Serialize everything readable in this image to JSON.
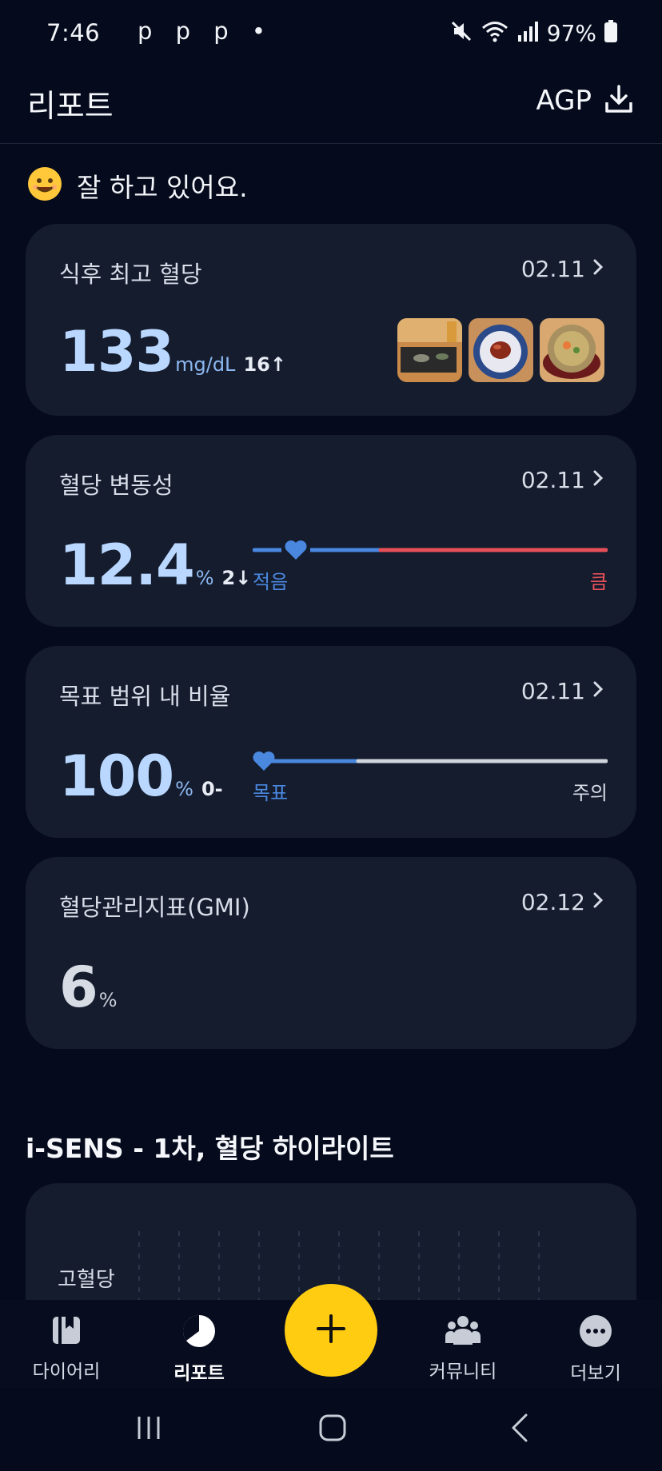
{
  "status_bar": {
    "time": "7:46",
    "notifications": "p p p •",
    "battery": "97%"
  },
  "header": {
    "title": "리포트",
    "agp_label": "AGP"
  },
  "greeting": {
    "text": "잘 하고 있어요."
  },
  "cards": {
    "post_meal": {
      "label": "식후 최고 혈당",
      "date": "02.11",
      "value": "133",
      "unit": "mg/dL",
      "delta": "16↑"
    },
    "variability": {
      "label": "혈당 변동성",
      "date": "02.11",
      "value": "12.4",
      "unit": "%",
      "delta": "2↓",
      "scale_low": "적음",
      "scale_high": "큼",
      "marker_fraction": 0.12
    },
    "time_in_range": {
      "label": "목표 범위 내 비율",
      "date": "02.11",
      "value": "100",
      "unit": "%",
      "delta": "0-",
      "scale_low": "목표",
      "scale_high": "주의",
      "marker_fraction": 0.0
    },
    "gmi": {
      "label": "혈당관리지표(GMI)",
      "date": "02.12",
      "value": "6",
      "unit": "%"
    }
  },
  "section": {
    "title": "i-SENS - 1차, 혈당 하이라이트",
    "high_label": "고혈당"
  },
  "bottom_nav": {
    "items": [
      {
        "label": "다이어리"
      },
      {
        "label": "리포트"
      },
      {
        "label": "커뮤니티"
      },
      {
        "label": "더보기"
      }
    ]
  },
  "colors": {
    "accent_blue": "#4a88e0",
    "warn_red": "#e85058",
    "fab_yellow": "#ffcc12"
  }
}
